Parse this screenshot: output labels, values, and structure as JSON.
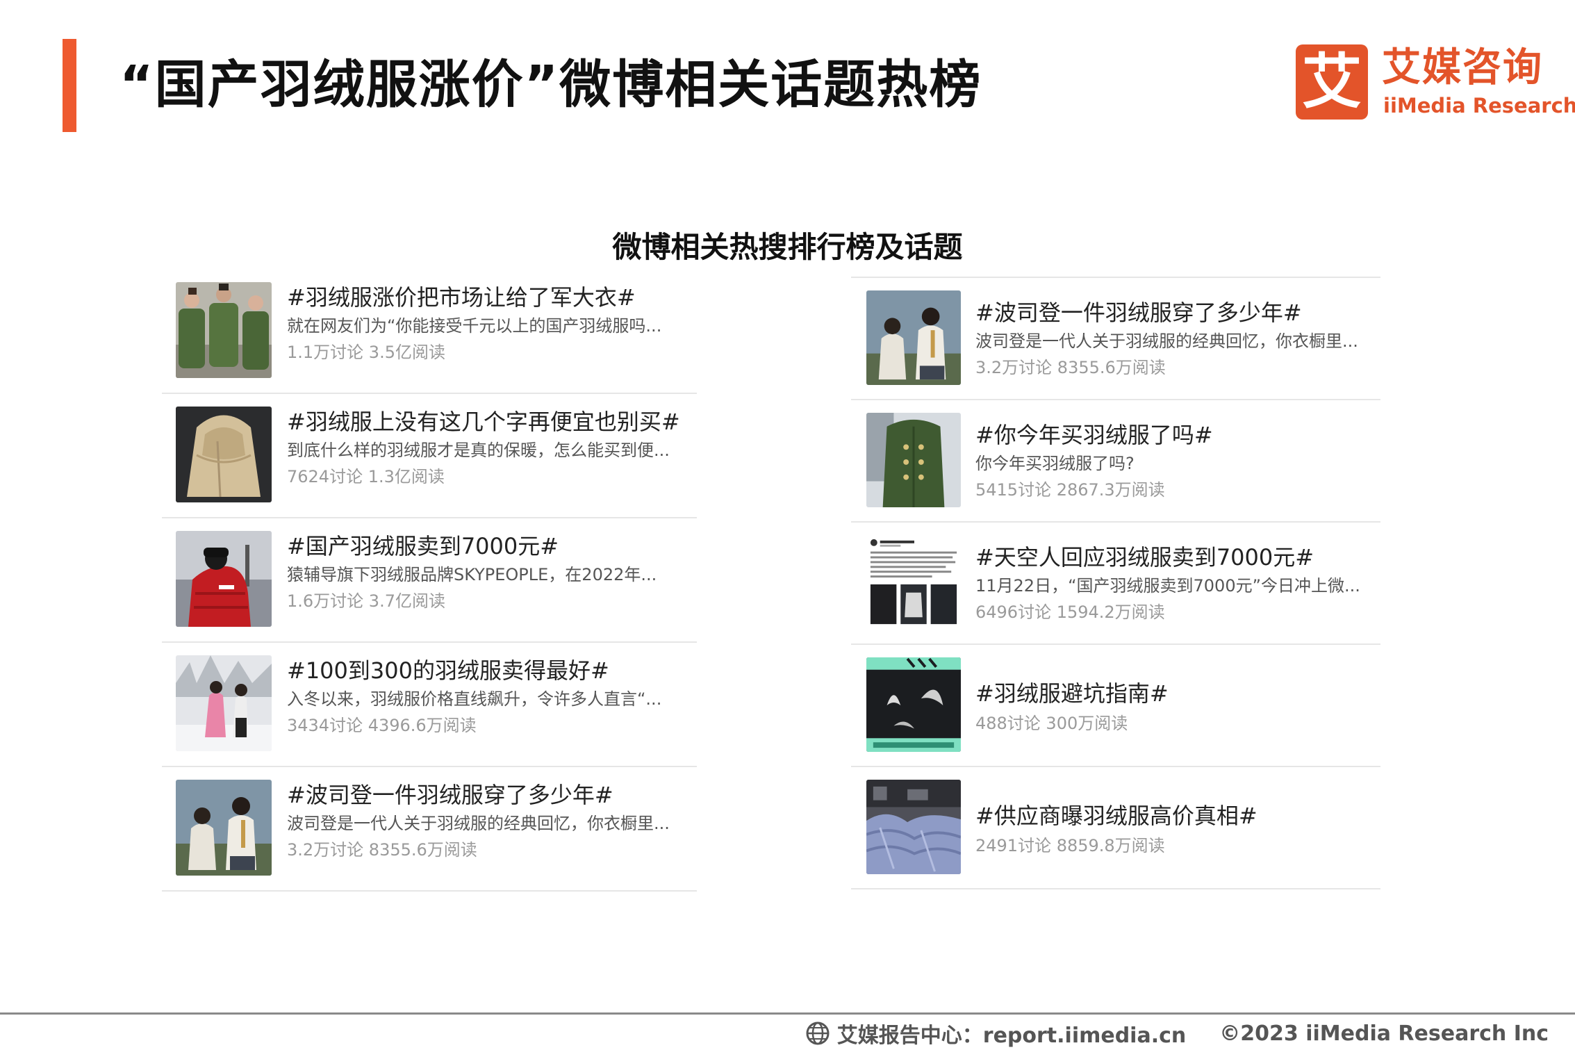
{
  "header": {
    "title": "“国产羽绒服涨价”微博相关话题热榜",
    "logo_cn": "艾媒咨询",
    "logo_en": "iiMedia Research",
    "logo_glyph": "艾",
    "accent_color": "#ee5a30",
    "brand_color": "#e3542a"
  },
  "section_title": "微博相关热搜排行榜及话题",
  "left_column": [
    {
      "title": "#羽绒服涨价把市场让给了军大衣#",
      "desc": "就在网友们为“你能接受千元以上的国产羽绒服吗...",
      "stats": "1.1万讨论 3.5亿阅读",
      "image": "three-people-green-coats-photo"
    },
    {
      "title": "#羽绒服上没有这几个字再便宜也别买#",
      "desc": "到底什么样的羽绒服才是真的保暖，怎么能买到便...",
      "stats": "7624讨论 1.3亿阅读",
      "image": "beige-down-coat-photo"
    },
    {
      "title": "#国产羽绒服卖到7000元#",
      "desc": "猿辅导旗下羽绒服品牌SKYPEOPLE，在2022年...",
      "stats": "1.6万讨论 3.7亿阅读",
      "image": "red-puffer-jacket-photo"
    },
    {
      "title": "#100到300的羽绒服卖得最好#",
      "desc": "入冬以来，羽绒服价格直线飙升，令许多人直言“...",
      "stats": "3434讨论 4396.6万阅读",
      "image": "snow-park-people-photo"
    },
    {
      "title": "#波司登一件羽绒服穿了多少年#",
      "desc": "波司登是一代人关于羽绒服的经典回忆，你衣橱里...",
      "stats": "3.2万讨论 8355.6万阅读",
      "image": "two-people-white-jackets-photo"
    }
  ],
  "right_column": [
    {
      "title": "#波司登一件羽绒服穿了多少年#",
      "desc": "波司登是一代人关于羽绒服的经典回忆，你衣橱里...",
      "stats": "3.2万讨论 8355.6万阅读",
      "image": "two-people-white-jackets-photo"
    },
    {
      "title": "#你今年买羽绒服了吗#",
      "desc": "你今年买羽绒服了吗?",
      "stats": "5415讨论 2867.3万阅读",
      "image": "army-green-coat-photo"
    },
    {
      "title": "#天空人回应羽绒服卖到7000元#",
      "desc": "11月22日，“国产羽绒服卖到7000元”今日冲上微...",
      "stats": "6496讨论 1594.2万阅读",
      "image": "weibo-post-screenshot"
    },
    {
      "title": "#羽绒服避坑指南#",
      "desc": "",
      "stats": "488讨论 300万阅读",
      "image": "down-feather-guide-graphic"
    },
    {
      "title": "#供应商曝羽绒服高价真相#",
      "desc": "",
      "stats": "2491讨论 8859.8万阅读",
      "image": "factory-down-jackets-photo"
    }
  ],
  "footer": {
    "source": "艾媒报告中心：report.iimedia.cn",
    "copyright": "©2023  iiMedia Research  Inc"
  }
}
